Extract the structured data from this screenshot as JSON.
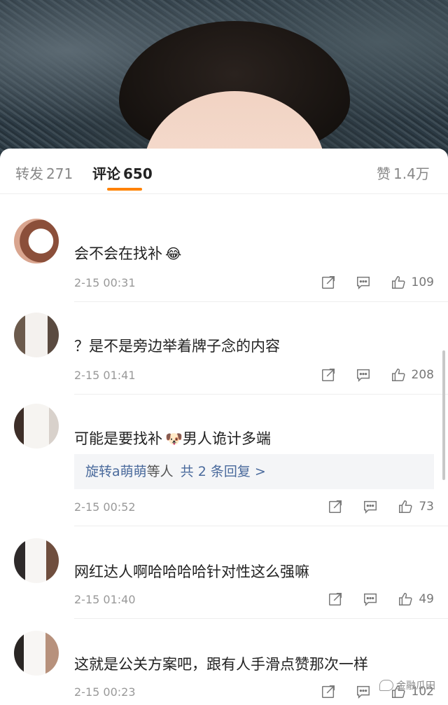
{
  "header": {
    "reposts_label": "转发",
    "reposts_count": "271",
    "comments_label": "评论",
    "comments_count": "650",
    "likes_label": "赞",
    "likes_count": "1.4万",
    "accent_color": "#ff8200"
  },
  "comments": [
    {
      "text": "会不会在找补",
      "emoji": "😂",
      "time": "2-15 00:31",
      "likes": "109"
    },
    {
      "text": "？是不是旁边举着牌子念的内容",
      "time": "2-15 01:41",
      "likes": "208"
    },
    {
      "text": "可能是要找补",
      "emoji": "🐶",
      "text_after": "男人诡计多端",
      "time": "2-15 00:52",
      "likes": "73",
      "reply": {
        "user": "旋转a萌萌",
        "rest": "等人",
        "count": "共 2 条回复 >"
      }
    },
    {
      "text": "网红达人啊哈哈哈哈针对性这么强嘛",
      "time": "2-15 01:40",
      "likes": "49"
    },
    {
      "text": "这就是公关方案吧，跟有人手滑点赞那次一样",
      "time": "2-15 00:23",
      "likes": "102"
    }
  ],
  "icons": {
    "share": "share-icon",
    "comment": "comment-icon",
    "like": "thumbs-up-icon"
  },
  "watermark": "金融瓜田"
}
